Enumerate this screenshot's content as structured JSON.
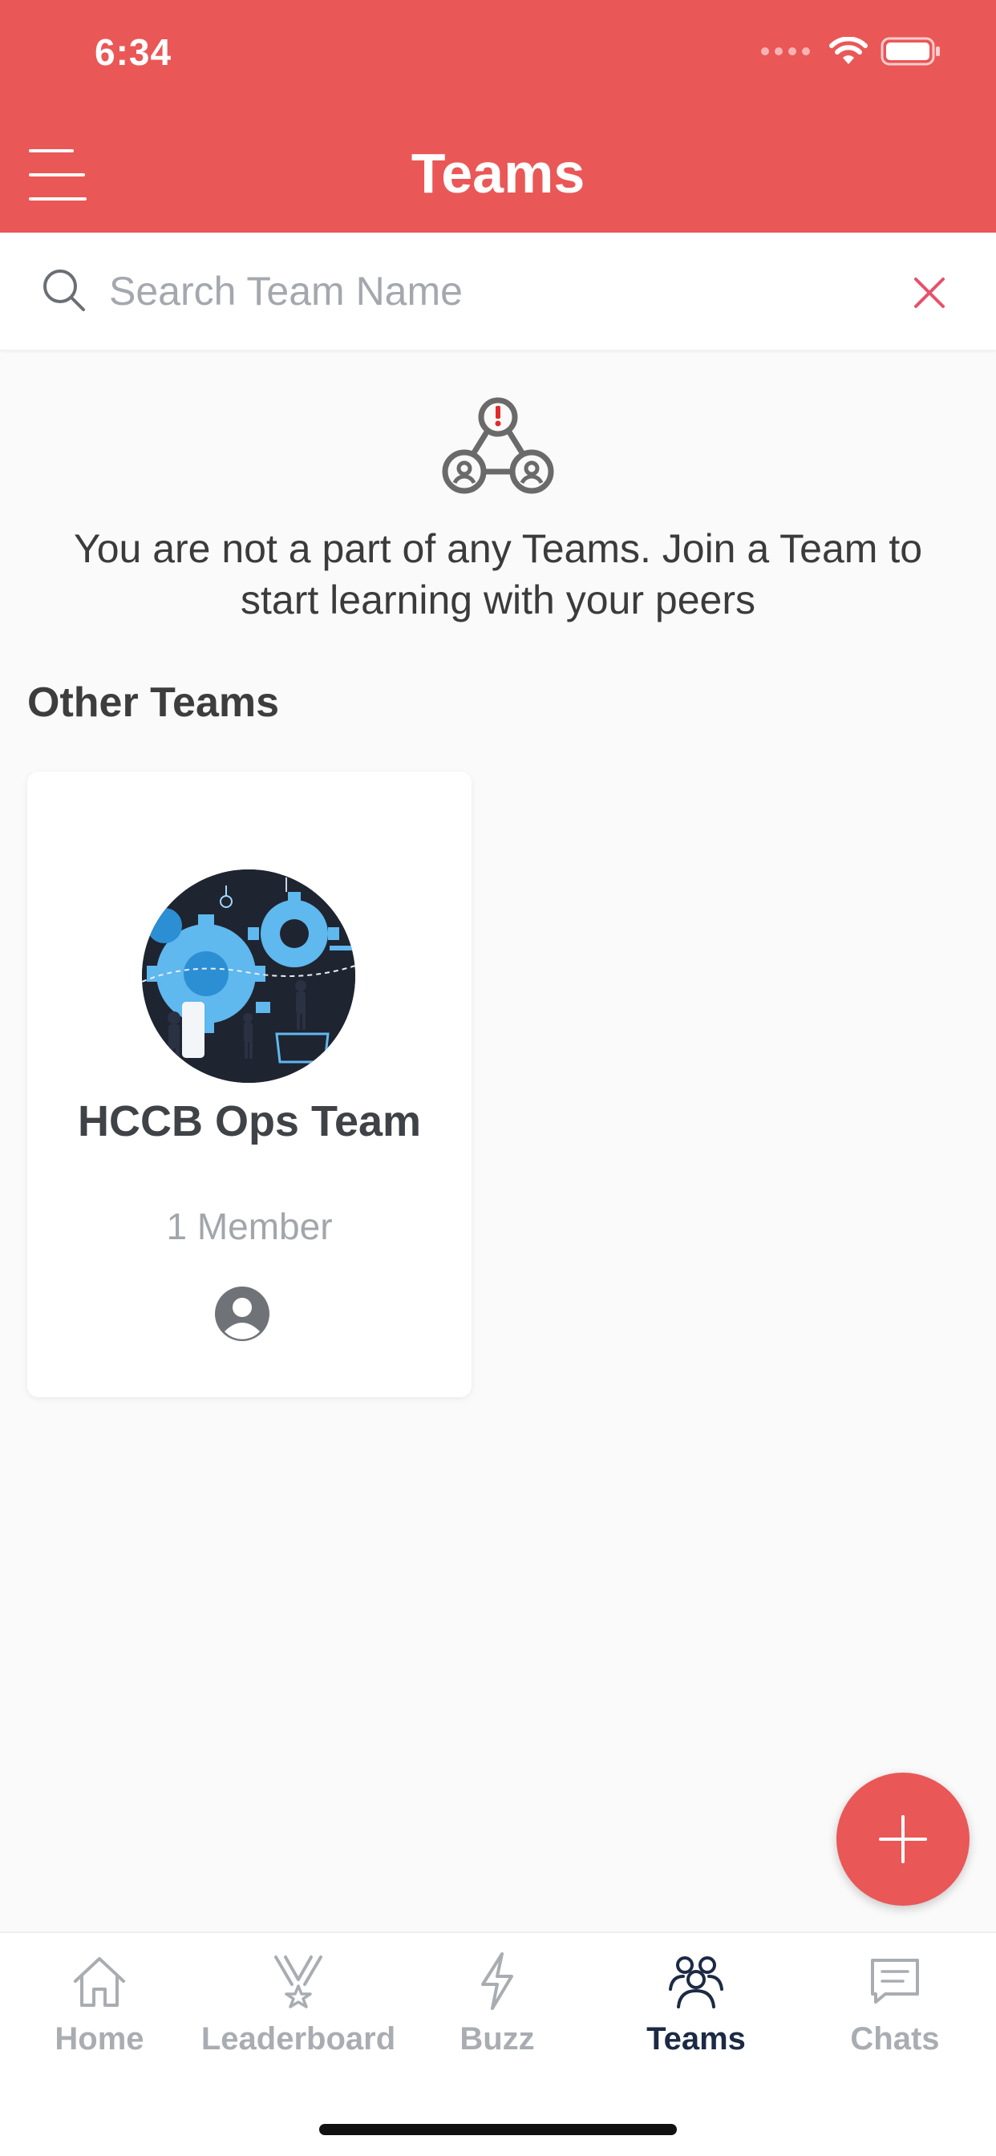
{
  "status_bar": {
    "time": "6:34"
  },
  "header": {
    "title": "Teams",
    "menu_icon": "hamburger-menu-icon"
  },
  "search": {
    "placeholder": "Search Team Name",
    "value": "",
    "clear_icon": "close-icon"
  },
  "empty_state": {
    "icon": "team-alert-icon",
    "message": "You are not a part of any Teams. Join a Team to start learning with your peers"
  },
  "other_teams": {
    "title": "Other Teams",
    "teams": [
      {
        "name": "HCCB Ops Team",
        "members": "1 Member"
      }
    ]
  },
  "fab": {
    "icon": "plus-icon"
  },
  "tabbar": {
    "items": [
      {
        "label": "Home",
        "icon": "home-icon",
        "active": false
      },
      {
        "label": "Leaderboard",
        "icon": "trophy-icon",
        "active": false
      },
      {
        "label": "Buzz",
        "icon": "bolt-icon",
        "active": false
      },
      {
        "label": "Teams",
        "icon": "teams-icon",
        "active": true
      },
      {
        "label": "Chats",
        "icon": "chat-icon",
        "active": false
      }
    ]
  },
  "colors": {
    "brand": "#ea5757",
    "active_tab": "#1c2a44",
    "inactive_tab": "#a9adb2"
  }
}
